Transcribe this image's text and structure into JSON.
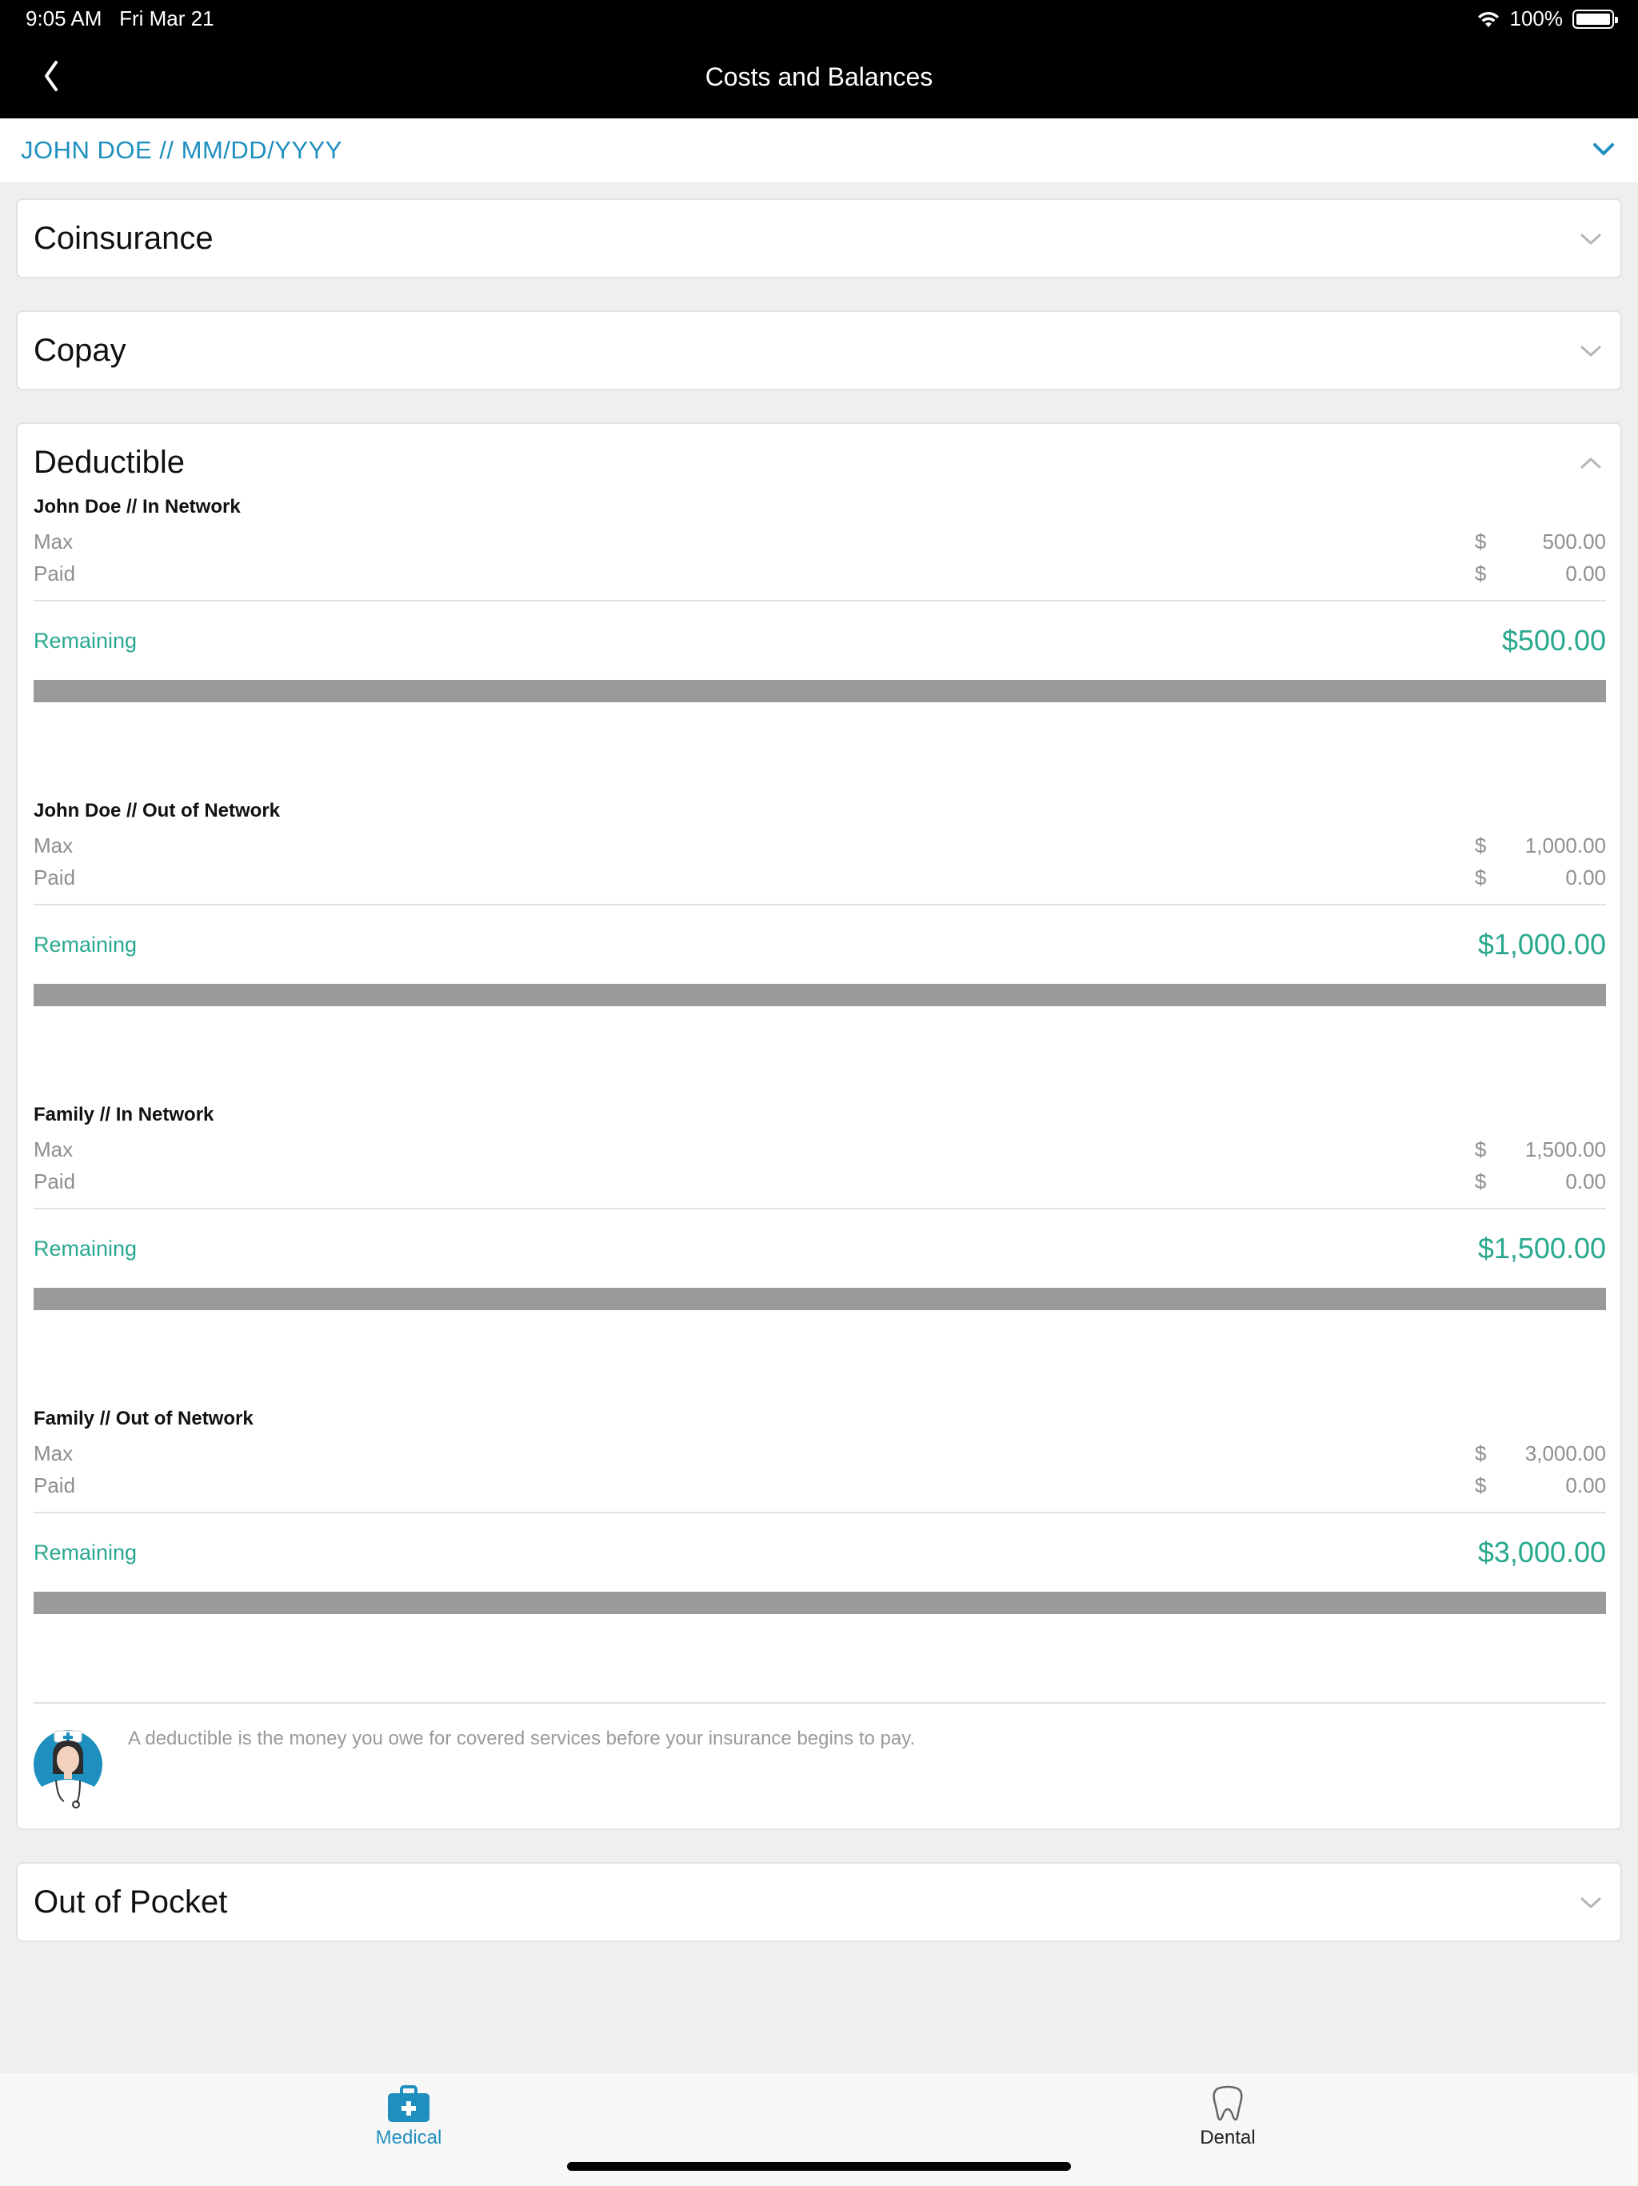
{
  "status_bar": {
    "time": "9:05 AM",
    "date": "Fri Mar 21",
    "battery": "100%"
  },
  "nav": {
    "title": "Costs and Balances"
  },
  "member_selector": {
    "label": "JOHN DOE // MM/DD/YYYY"
  },
  "colors": {
    "accent_blue": "#1f8fbf",
    "remaining_green": "#2aa88f",
    "progress_track": "#9a9a9a"
  },
  "cards": {
    "coinsurance": {
      "title": "Coinsurance"
    },
    "copay": {
      "title": "Copay"
    },
    "deductible": {
      "title": "Deductible",
      "sections": [
        {
          "heading": "John Doe // In Network",
          "max_label": "Max",
          "paid_label": "Paid",
          "currency": "$",
          "max": "500.00",
          "paid": "0.00",
          "remaining_label": "Remaining",
          "remaining": "$500.00",
          "paid_fraction": 0
        },
        {
          "heading": "John Doe // Out of Network",
          "max_label": "Max",
          "paid_label": "Paid",
          "currency": "$",
          "max": "1,000.00",
          "paid": "0.00",
          "remaining_label": "Remaining",
          "remaining": "$1,000.00",
          "paid_fraction": 0
        },
        {
          "heading": "Family // In Network",
          "max_label": "Max",
          "paid_label": "Paid",
          "currency": "$",
          "max": "1,500.00",
          "paid": "0.00",
          "remaining_label": "Remaining",
          "remaining": "$1,500.00",
          "paid_fraction": 0
        },
        {
          "heading": "Family // Out of Network",
          "max_label": "Max",
          "paid_label": "Paid",
          "currency": "$",
          "max": "3,000.00",
          "paid": "0.00",
          "remaining_label": "Remaining",
          "remaining": "$3,000.00",
          "paid_fraction": 0
        }
      ],
      "info": "A deductible is the money you owe for covered services before your insurance begins to pay.",
      "info_icon": "nurse-avatar"
    },
    "out_of_pocket": {
      "title": "Out of Pocket"
    }
  },
  "tabbar": {
    "medical": {
      "label": "Medical",
      "icon": "medical-kit-icon",
      "active": true
    },
    "dental": {
      "label": "Dental",
      "icon": "tooth-icon",
      "active": false
    }
  }
}
